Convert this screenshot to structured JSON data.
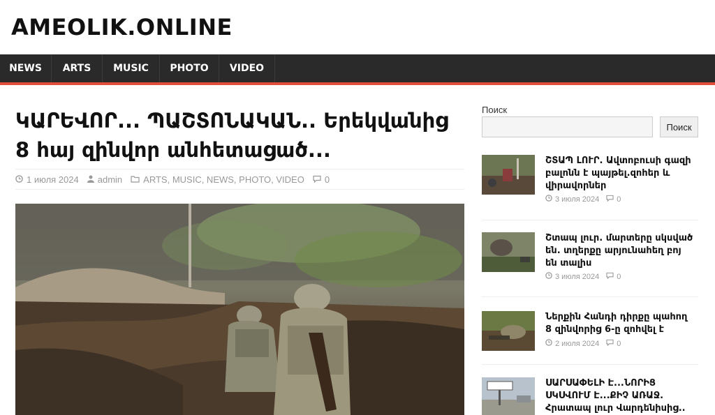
{
  "site": {
    "title": "AMEOLIK.ONLINE"
  },
  "nav": [
    {
      "label": "NEWS"
    },
    {
      "label": "ARTS"
    },
    {
      "label": "MUSIC"
    },
    {
      "label": "PHOTO"
    },
    {
      "label": "VIDEO"
    }
  ],
  "post": {
    "title": "ԿԱՐԵՎՈՐ... ՊԱՇՏՈՆԱԿԱՆ.. Երեկվանից 8 հայ զինվոր անհետացած...",
    "date": "1 июля 2024",
    "author": "admin",
    "categories": "ARTS, MUSIC, NEWS, PHOTO, VIDEO",
    "comments": "0",
    "image_alt": "soldiers-in-trench-photo"
  },
  "sidebar": {
    "search_label": "Поиск",
    "search_value": "",
    "search_button": "Поиск",
    "posts": [
      {
        "title": "ՇՏԱՊ ԼՈՒՐ. Ավտոբուսի գազի բալոնն է պայթել.զոհեր և վիրավորներ",
        "date": "3 июля 2024",
        "comments": "0"
      },
      {
        "title": "Շտապ լուր. մարտերը սկսված են. տղերքը արյունահեղ բոյ են տալիս",
        "date": "3 июля 2024",
        "comments": "0"
      },
      {
        "title": "Ներքին Հանդի դիրքը պահող 8 զինվորից 6-ը զոհվել է",
        "date": "2 июля 2024",
        "comments": "0"
      },
      {
        "title": "ՍԱՐՍԱՓԵԼԻ Է...ՆՈՐԻՑ ՍԿՍՎՈՒՄ Է...ՔԻՉ ԱՌԱՋ. Հրատապ լուր Վարդենիսից..",
        "date": "",
        "comments": ""
      }
    ]
  },
  "icons": {
    "clock": "clock-icon",
    "user": "user-icon",
    "folder": "folder-icon",
    "comment": "comment-icon"
  },
  "colors": {
    "nav_bg": "#2a2a2a",
    "accent": "#e04e39"
  }
}
